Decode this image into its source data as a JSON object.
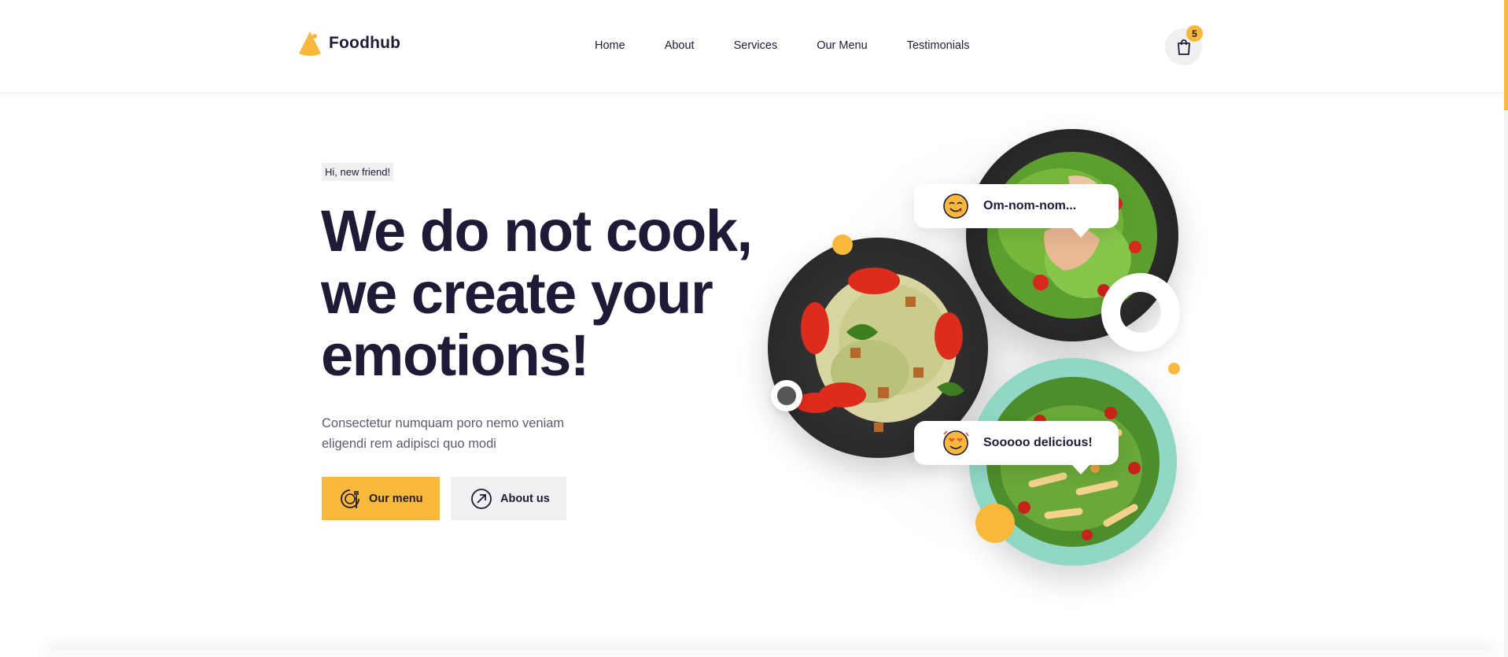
{
  "header": {
    "brand": "Foodhub",
    "nav": [
      "Home",
      "About",
      "Services",
      "Our Menu",
      "Testimonials"
    ],
    "cart_count": "5"
  },
  "hero": {
    "greeting": "Hi, new friend!",
    "headline_lines": [
      "We do not cook,",
      "we create your",
      "emotions!"
    ],
    "description": "Consectetur numquam poro nemo veniam eligendi rem adipisci quo modi",
    "primary_button": "Our menu",
    "secondary_button": "About us"
  },
  "bubbles": {
    "top": "Om-nom-nom...",
    "bottom": "Sooooo delicious!"
  },
  "colors": {
    "accent": "#f8b83c",
    "text_dark": "#1e1b36",
    "muted": "#5c5b6e",
    "light_gray": "#eef0f2",
    "plate_dark": "#2b2b2b",
    "plate_mint": "#8fd6c4"
  },
  "icons": {
    "logo": "foodhub-logo-icon",
    "cart": "shopping-bag-icon",
    "menu_btn": "plate-fork-icon",
    "about_btn": "arrow-up-right-circle-icon",
    "bubble_top": "yum-face-emoji",
    "bubble_bottom": "love-face-emoji"
  }
}
